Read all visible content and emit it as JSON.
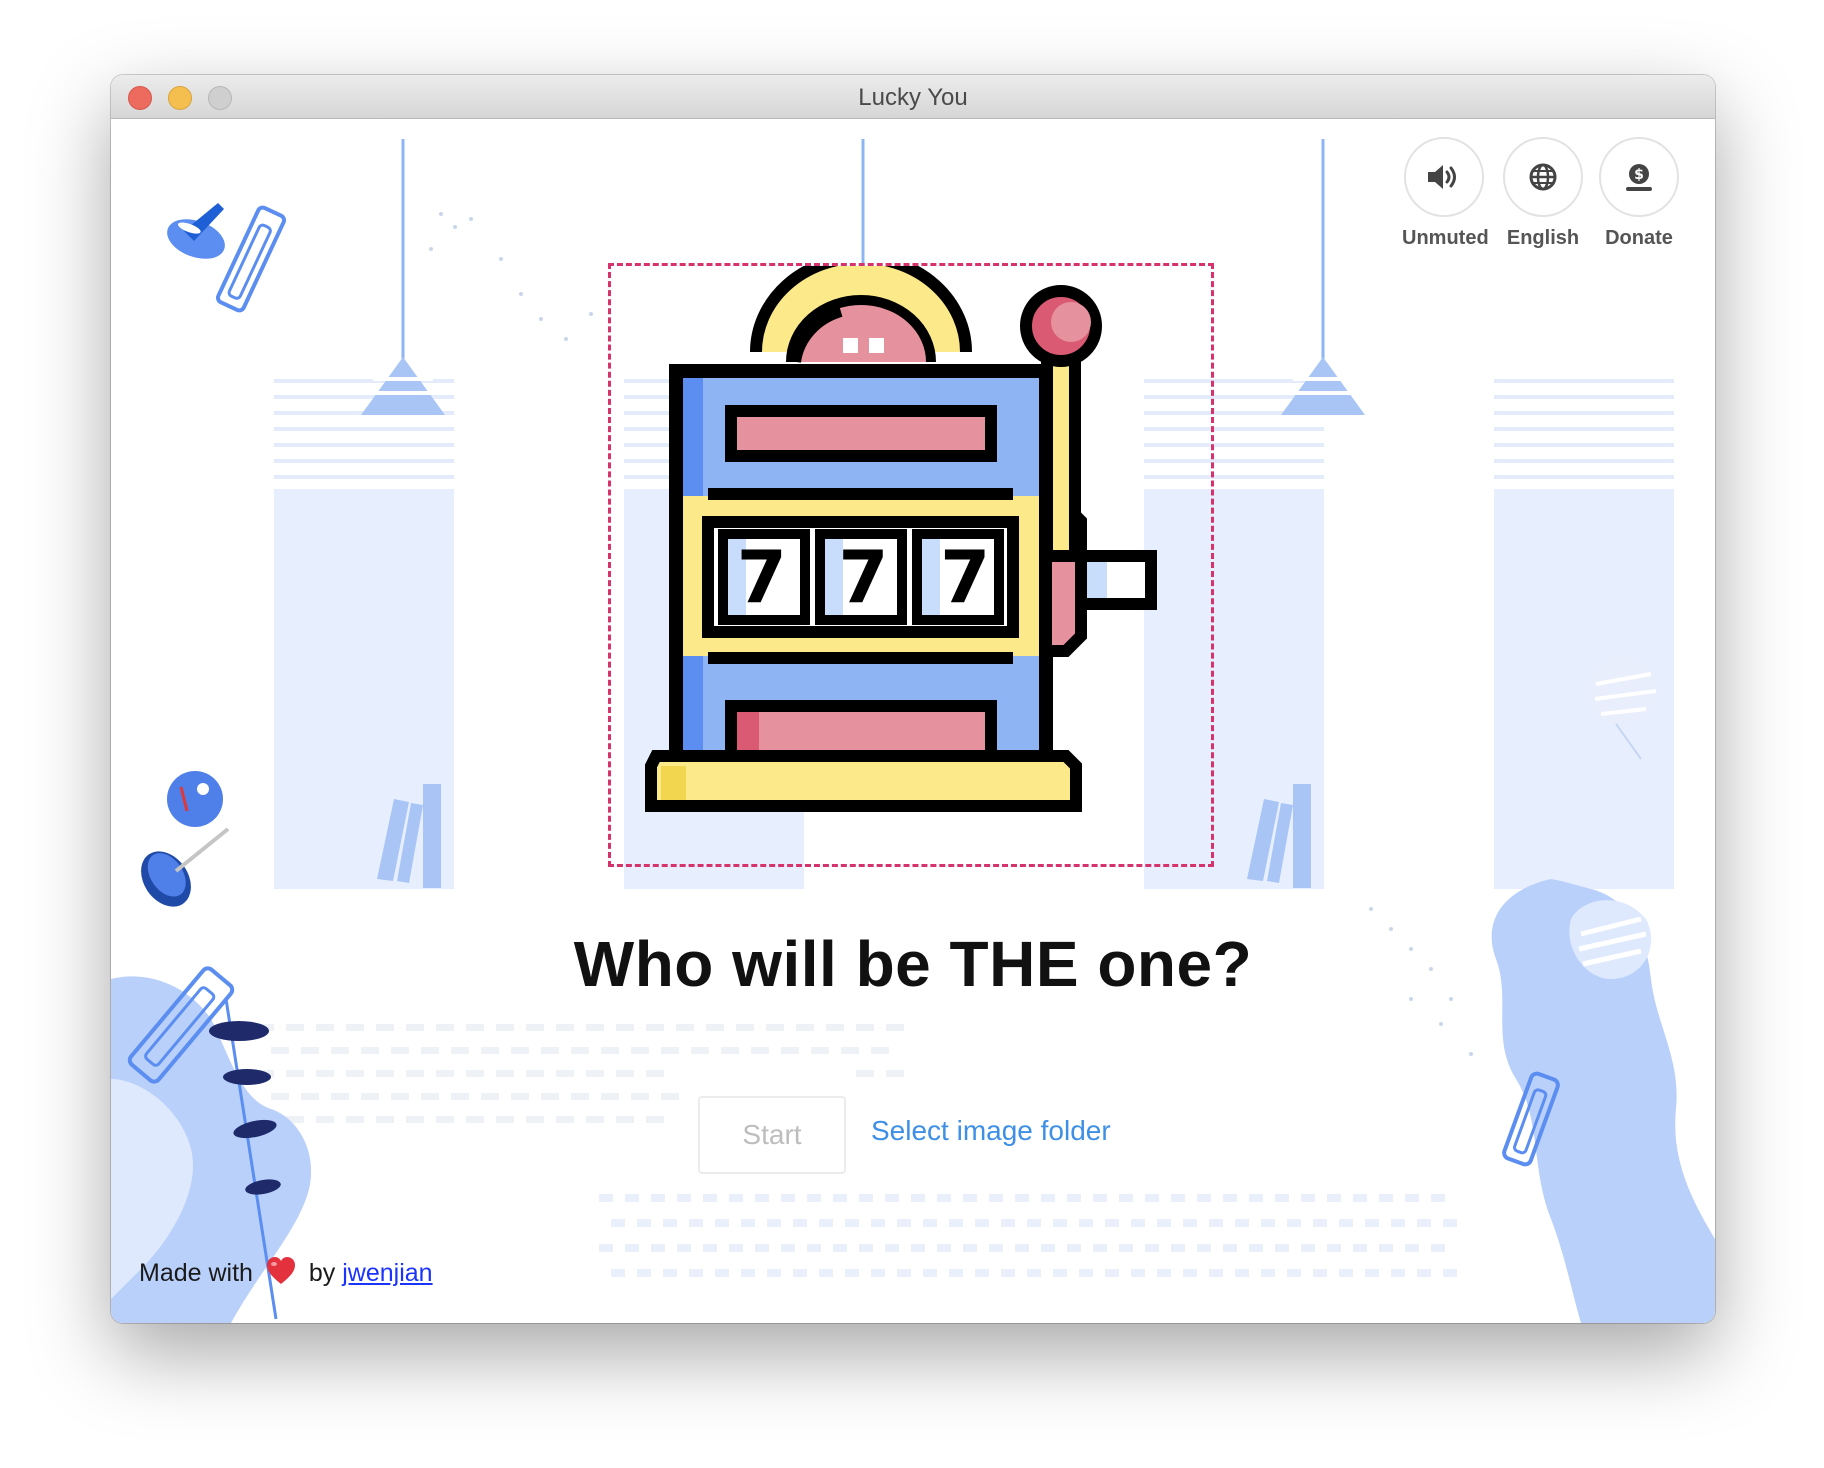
{
  "window": {
    "title": "Lucky You"
  },
  "toolbar": {
    "sound_label": "Unmuted",
    "language_label": "English",
    "donate_label": "Donate"
  },
  "main": {
    "headline": "Who will be THE one?",
    "start_label": "Start",
    "select_folder_label": "Select image folder"
  },
  "slot_machine": {
    "reels": [
      "7",
      "7",
      "7"
    ]
  },
  "footer": {
    "made_with": "Made with",
    "by": "by",
    "author": "jwenjian"
  },
  "colors": {
    "accent_blue": "#3e8fe6",
    "dashed_border": "#d6336c",
    "illustration_blue": "#8eb4f4",
    "machine_yellow": "#fbe98a",
    "machine_pink": "#e6919e"
  }
}
